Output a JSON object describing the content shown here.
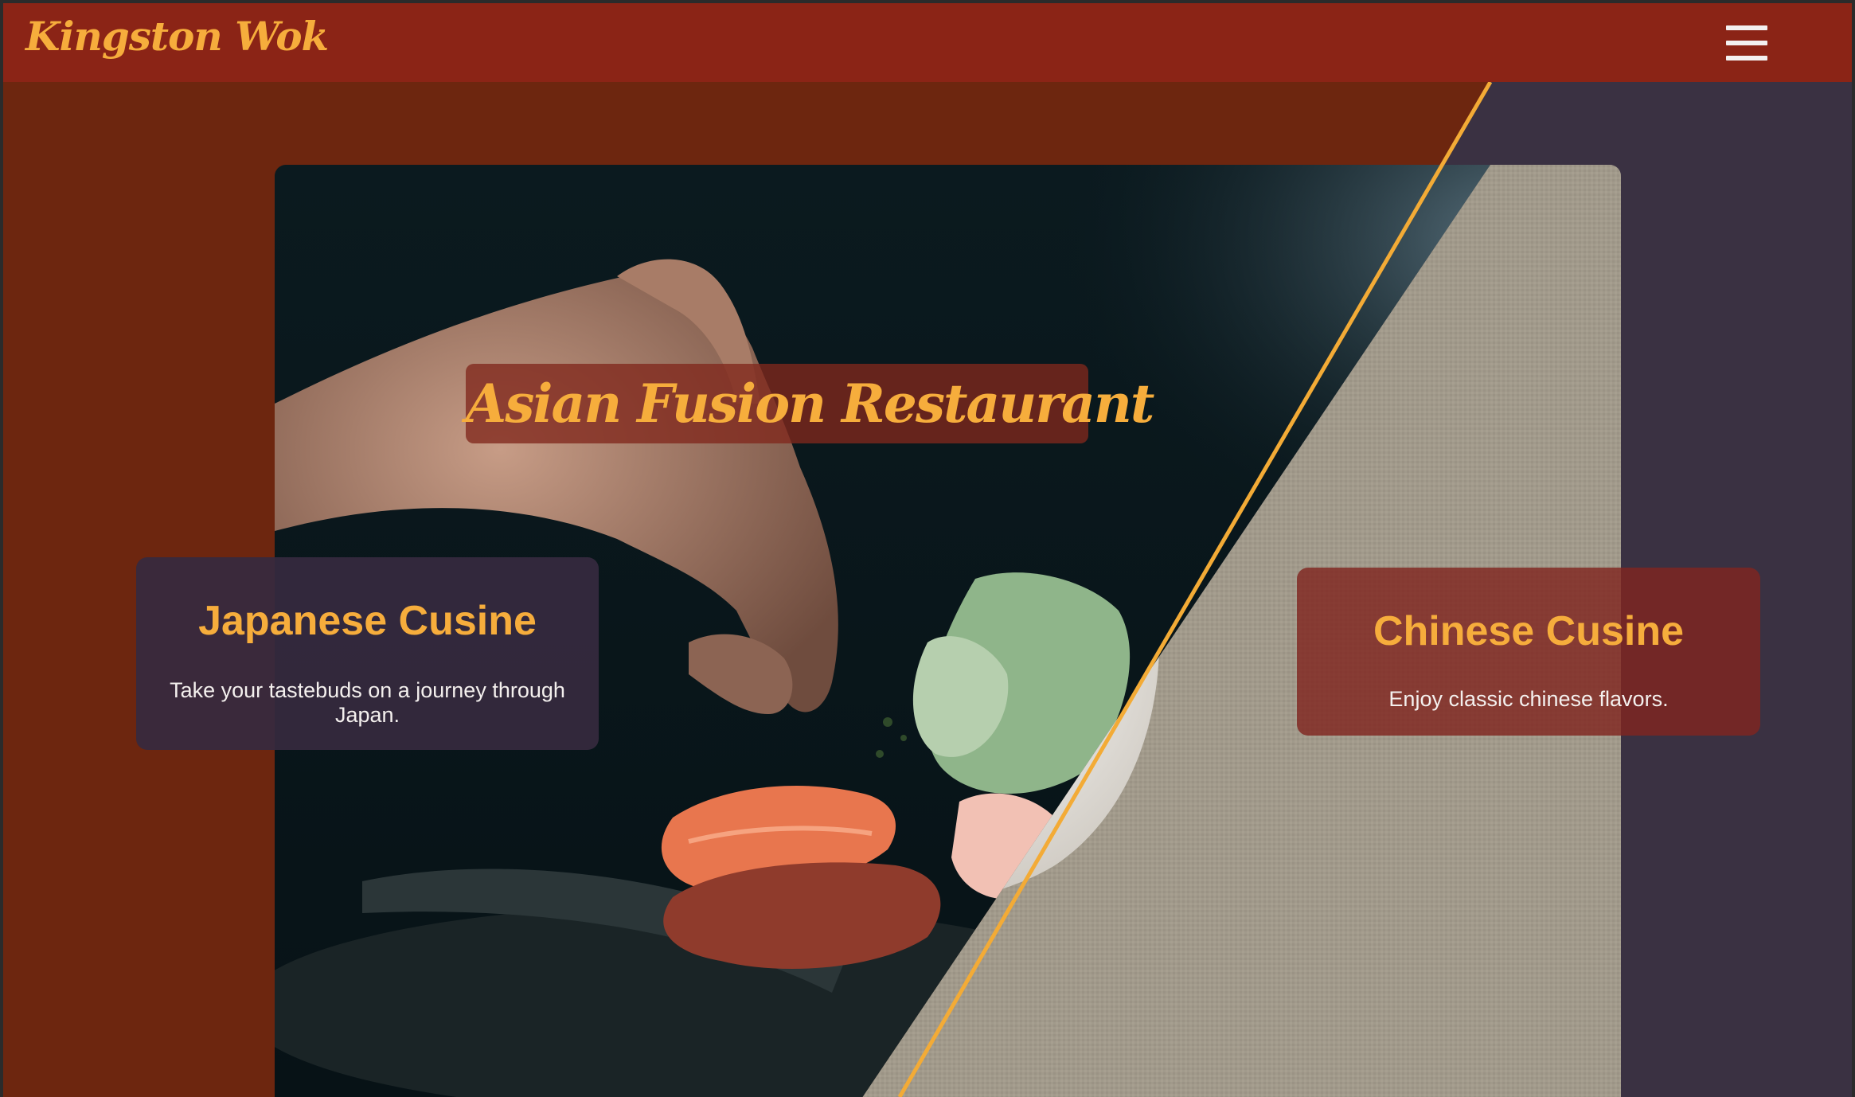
{
  "navbar": {
    "brand": "Kingston Wok",
    "menu_icon": "hamburger-menu-icon"
  },
  "hero": {
    "title": "Asian Fusion Restaurant",
    "left_image": "sushi-plating-photo",
    "right_image": "noodle-bowl-photo"
  },
  "cards": {
    "japanese": {
      "title": "Japanese Cusine",
      "description": "Take your tastebuds on a journey through Japan."
    },
    "chinese": {
      "title": "Chinese Cusine",
      "description": "Enjoy classic chinese flavors."
    }
  },
  "colors": {
    "navbar_bg": "#8b2416",
    "page_bg_left": "#6d260f",
    "page_bg_right": "#3a3142",
    "accent": "#f6ad3c",
    "divider": "#f3ab36"
  }
}
